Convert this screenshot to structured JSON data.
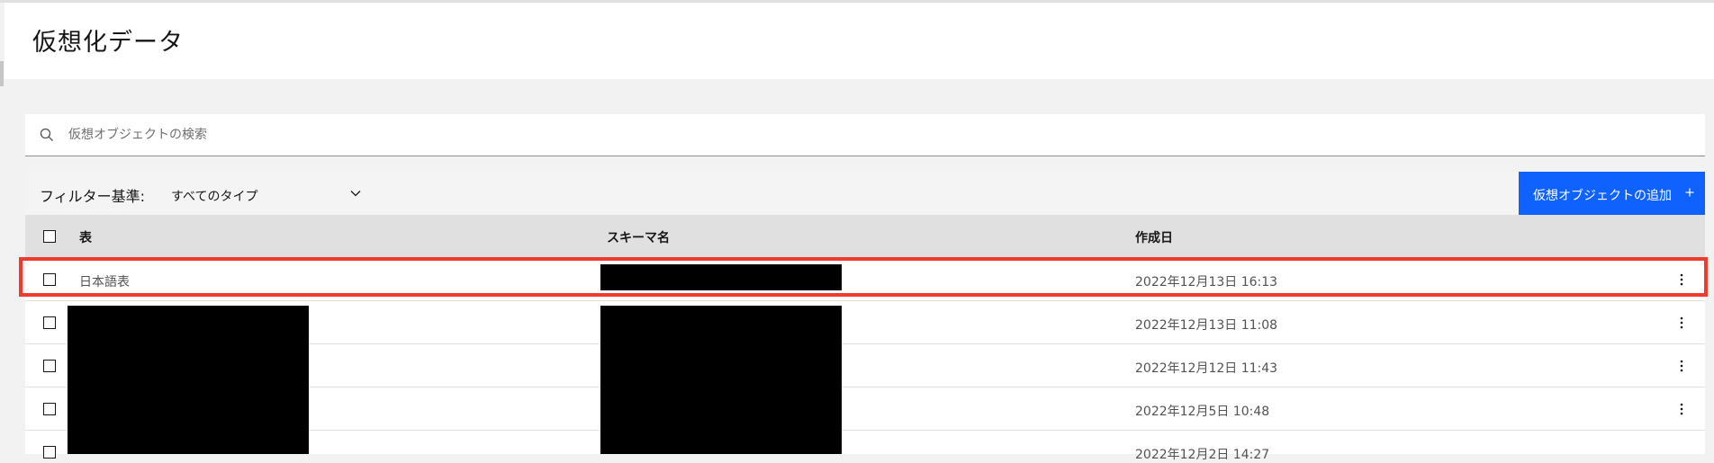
{
  "header": {
    "title": "仮想化データ"
  },
  "search": {
    "placeholder": "仮想オブジェクトの検索",
    "icon": "search-icon"
  },
  "toolbar": {
    "filter_label": "フィルター基準:",
    "filter_value": "すべてのタイプ",
    "add_button_label": "仮想オブジェクトの追加",
    "add_button_icon": "plus-icon"
  },
  "table": {
    "columns": [
      "表",
      "スキーマ名",
      "作成日"
    ],
    "rows": [
      {
        "table": "日本語表",
        "schema": "",
        "created": "2022年12月13日 16:13"
      },
      {
        "table": "",
        "schema": "",
        "created": "2022年12月13日 11:08"
      },
      {
        "table": "",
        "schema": "",
        "created": "2022年12月12日 11:43"
      },
      {
        "table": "",
        "schema": "",
        "created": "2022年12月5日 10:48"
      },
      {
        "table": "",
        "schema": "",
        "created": "2022年12月2日 14:27"
      }
    ]
  },
  "colors": {
    "primary_button": "#0f62fe",
    "highlight": "#f03a2e",
    "table_header": "#e0e0e0",
    "page_background": "#f2f2f2"
  }
}
